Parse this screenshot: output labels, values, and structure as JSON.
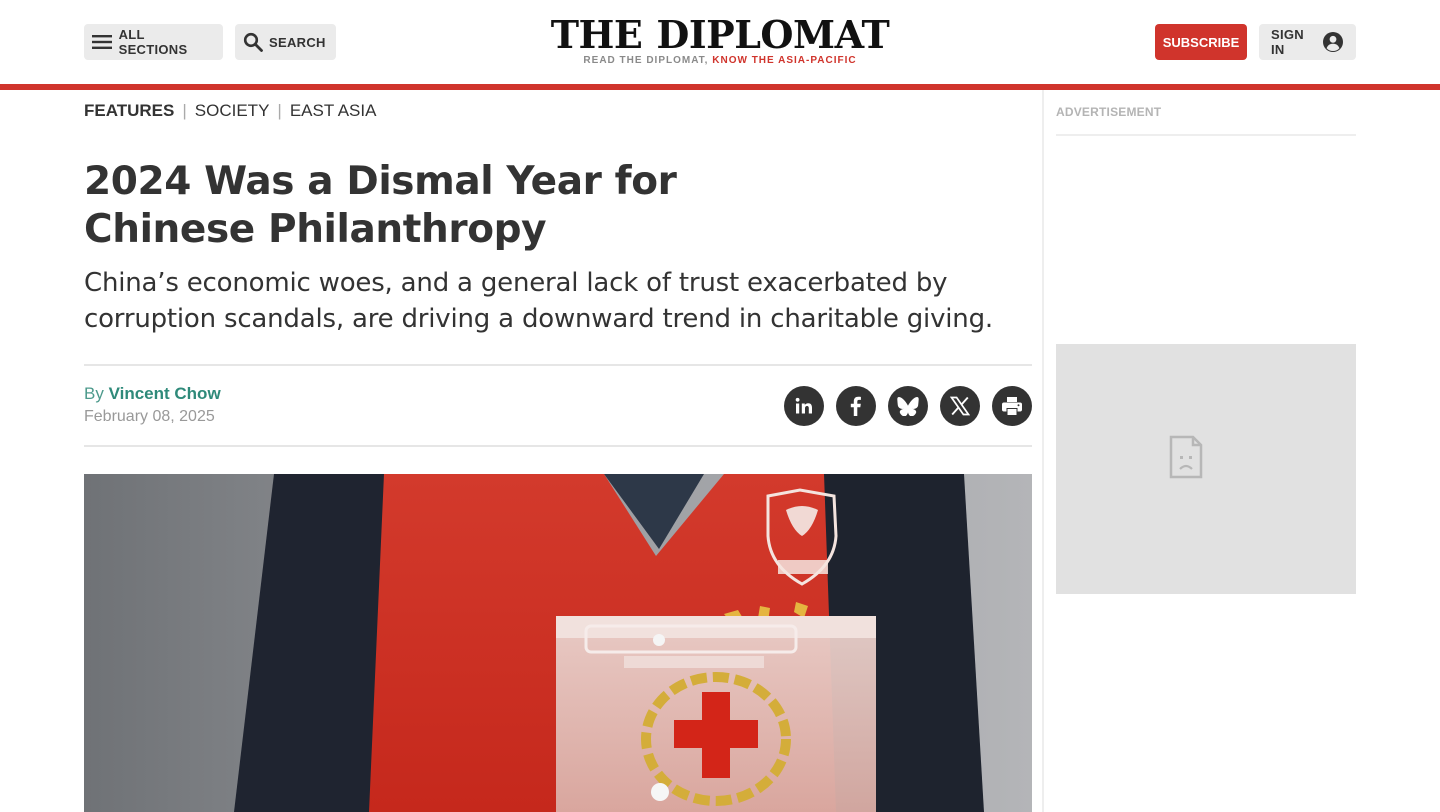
{
  "header": {
    "sections_label": "ALL SECTIONS",
    "search_label": "SEARCH",
    "subscribe_label": "SUBSCRIBE",
    "signin_label": "SIGN IN",
    "logo_left": "THE",
    "logo_right": "DIPLOMAT",
    "tagline_grey": "READ THE DIPLOMAT,",
    "tagline_red": "KNOW THE ASIA-PACIFIC",
    "accent_color": "#d0342c"
  },
  "breadcrumb": {
    "items": [
      "FEATURES",
      "SOCIETY",
      "EAST ASIA"
    ]
  },
  "article": {
    "title": "2024 Was a Dismal Year for Chinese Philanthropy",
    "deck": "China’s economic woes, and a general lack of trust exacerbated by corruption scandals, are driving a downward trend in charitable giving.",
    "by": "By",
    "author": "Vincent Chow",
    "date": "February 08, 2025",
    "hero_image": "person-in-red-volunteer-vest-holding-red-cross-donation-box",
    "share_icons": [
      "linkedin-icon",
      "facebook-icon",
      "bluesky-icon",
      "x-icon",
      "print-icon"
    ]
  },
  "sidebar": {
    "ad_label": "ADVERTISEMENT",
    "ad_placeholder_icon": "broken-image-icon"
  }
}
